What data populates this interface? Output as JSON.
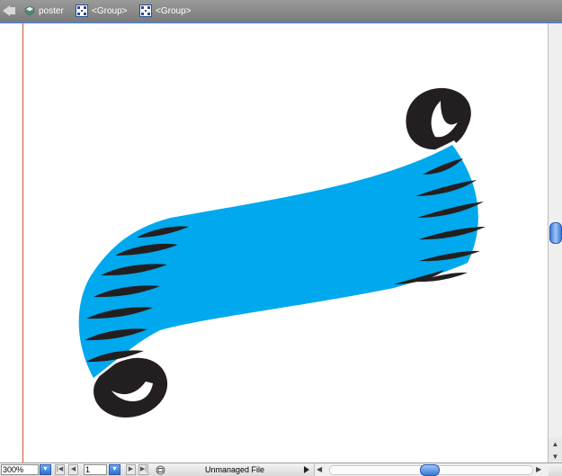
{
  "breadcrumb": {
    "items": [
      {
        "label": "poster"
      },
      {
        "label": "<Group>"
      },
      {
        "label": "<Group>"
      }
    ]
  },
  "artwork": {
    "banner_color": "#00a8ed",
    "curl_color": "#231f20",
    "guide_color": "#c7543a"
  },
  "statusbar": {
    "zoom": "300%",
    "page": "1",
    "status_text": "Unmanaged File"
  }
}
